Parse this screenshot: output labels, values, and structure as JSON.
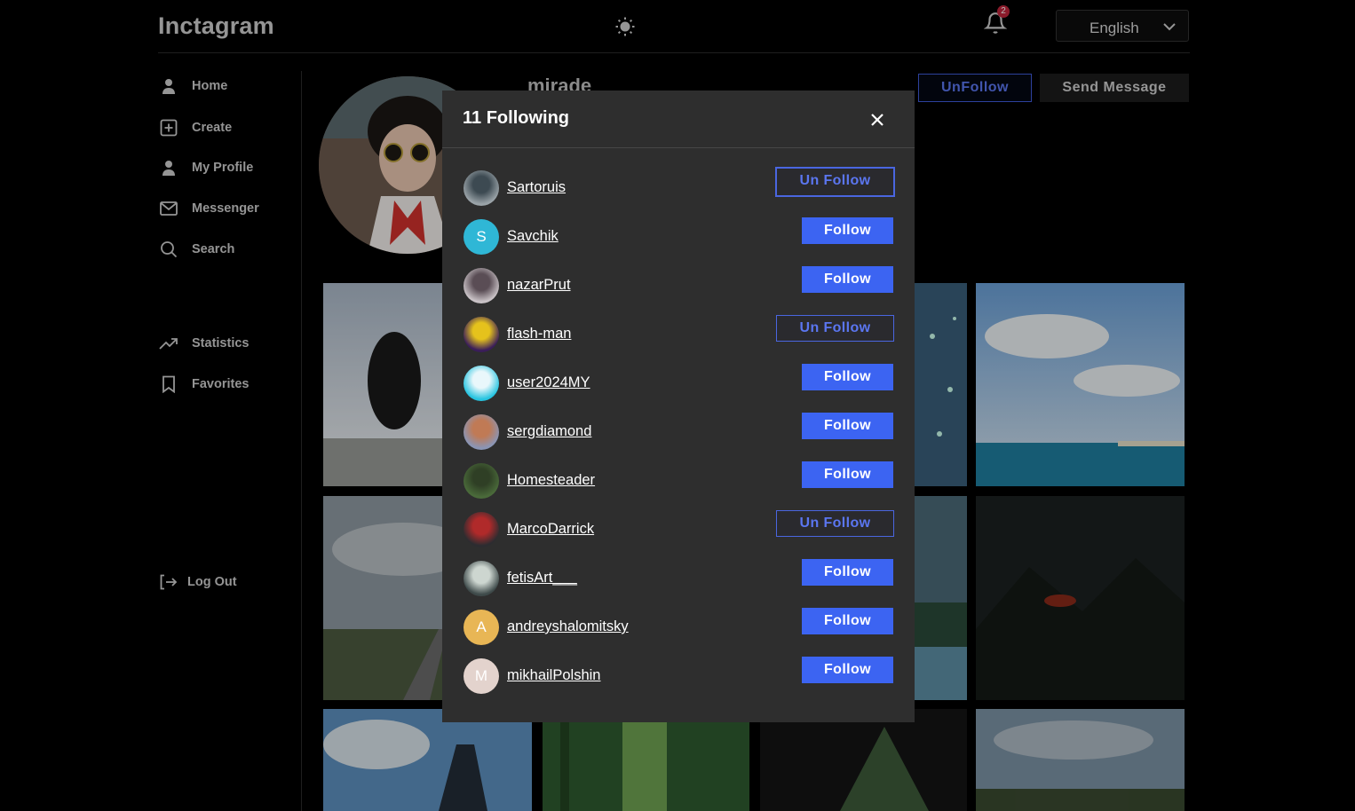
{
  "header": {
    "logo": "Inctagram",
    "notification_count": "2",
    "language": "English"
  },
  "sidebar": {
    "items": [
      {
        "label": "Home",
        "icon": "user-icon"
      },
      {
        "label": "Create",
        "icon": "plus-square-icon"
      },
      {
        "label": "My Profile",
        "icon": "user-icon"
      },
      {
        "label": "Messenger",
        "icon": "mail-icon"
      },
      {
        "label": "Search",
        "icon": "search-icon"
      },
      {
        "label": "Statistics",
        "icon": "trending-up-icon"
      },
      {
        "label": "Favorites",
        "icon": "bookmark-icon"
      }
    ],
    "logout": "Log Out"
  },
  "profile": {
    "username": "mirade",
    "unfollow_label": "UnFollow",
    "send_message_label": "Send Message"
  },
  "modal": {
    "title": "11 Following",
    "users": [
      {
        "name": "Sartoruis",
        "action": "Un Follow",
        "avatar": "photo",
        "colors": [
          "#9aa3a8",
          "#3d4a52"
        ]
      },
      {
        "name": "Savchik",
        "action": "Follow",
        "avatar": "letter",
        "letter": "S",
        "colors": [
          "#2fb7d6",
          "#2fb7d6"
        ]
      },
      {
        "name": "nazarPrut",
        "action": "Follow",
        "avatar": "photo",
        "colors": [
          "#c9c2c6",
          "#5a4d55"
        ]
      },
      {
        "name": "flash-man",
        "action": "Un Follow",
        "avatar": "photo",
        "colors": [
          "#3a1d5a",
          "#e5c21c"
        ]
      },
      {
        "name": "user2024MY",
        "action": "Follow",
        "avatar": "photo",
        "colors": [
          "#27c4e0",
          "#e9f7fb"
        ]
      },
      {
        "name": "sergdiamond",
        "action": "Follow",
        "avatar": "photo",
        "colors": [
          "#8a95b5",
          "#c07a55"
        ]
      },
      {
        "name": "Homesteader",
        "action": "Follow",
        "avatar": "photo",
        "colors": [
          "#4a6a3a",
          "#2f3f25"
        ]
      },
      {
        "name": "MarcoDarrick",
        "action": "Un Follow",
        "avatar": "photo",
        "colors": [
          "#2c2c30",
          "#b02a2a"
        ]
      },
      {
        "name": "fetisArt___",
        "action": "Follow",
        "avatar": "photo",
        "colors": [
          "#3e4a4a",
          "#cdd6d0"
        ]
      },
      {
        "name": "andreyshalomitsky",
        "action": "Follow",
        "avatar": "letter",
        "letter": "A",
        "colors": [
          "#e8b655",
          "#e8b655"
        ]
      },
      {
        "name": "mikhailPolshin",
        "action": "Follow",
        "avatar": "letter",
        "letter": "M",
        "colors": [
          "#e3d3cd",
          "#e3d3cd"
        ]
      }
    ]
  },
  "colors": {
    "accent": "#3c64f2",
    "modal_bg": "#2e2e2e",
    "badge": "#c0263c"
  }
}
